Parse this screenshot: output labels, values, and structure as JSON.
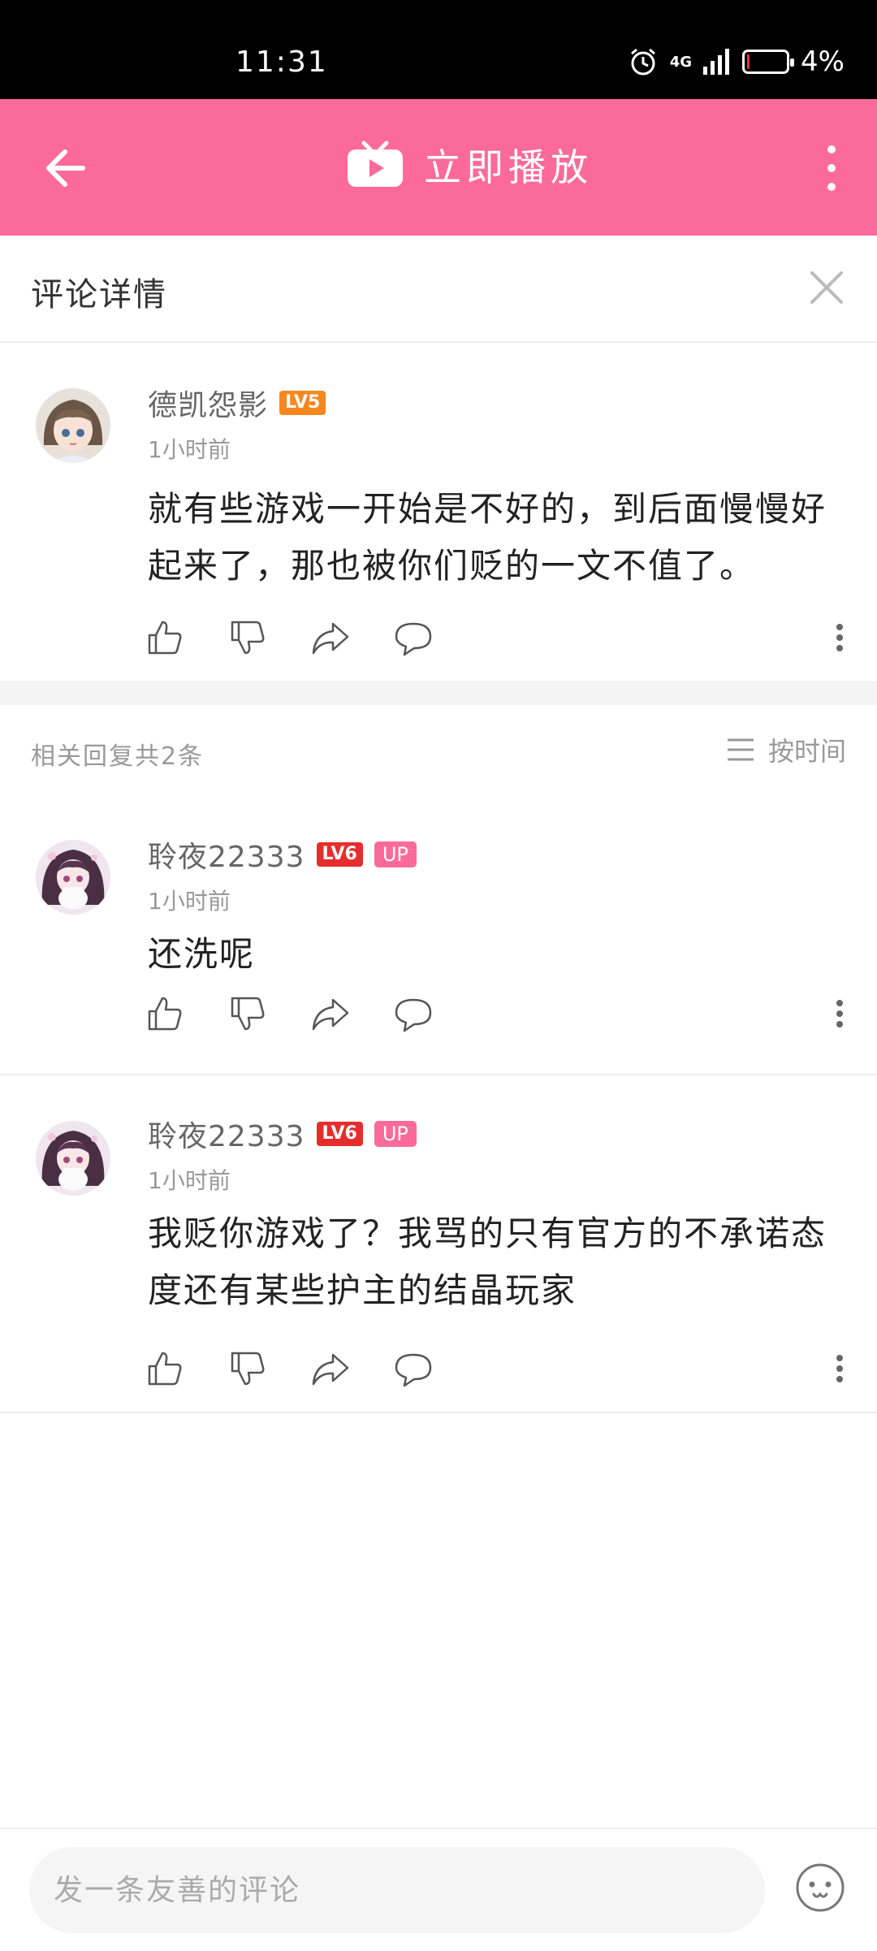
{
  "status_bar": {
    "time": "11:31",
    "network": "4G",
    "battery": "4%"
  },
  "header": {
    "title": "立即播放"
  },
  "detail": {
    "title": "评论详情"
  },
  "main_comment": {
    "username": "德凯怨影",
    "level": "LV5",
    "time": "1小时前",
    "text": "就有些游戏一开始是不好的，到后面慢慢好起来了，那也被你们贬的一文不值了。"
  },
  "replies_header": {
    "count_text": "相关回复共2条",
    "sort_label": "按时间"
  },
  "replies": [
    {
      "username": "聆夜22333",
      "level": "LV6",
      "badge": "UP",
      "time": "1小时前",
      "text": "还洗呢"
    },
    {
      "username": "聆夜22333",
      "level": "LV6",
      "badge": "UP",
      "time": "1小时前",
      "text": "我贬你游戏了？我骂的只有官方的不承诺态度还有某些护主的结晶玩家"
    }
  ],
  "bottom": {
    "input_placeholder": "发一条友善的评论"
  },
  "colors": {
    "brand_pink": "#fb6a9a",
    "lv5": "#f6871f",
    "lv6": "#e52d2d"
  },
  "icons": [
    "back-arrow-icon",
    "tv-play-icon",
    "more-vert-icon",
    "close-icon",
    "like-icon",
    "dislike-icon",
    "share-icon",
    "reply-icon",
    "sort-lines-icon",
    "emoji-icon",
    "alarm-icon",
    "signal-icon",
    "battery-icon"
  ]
}
